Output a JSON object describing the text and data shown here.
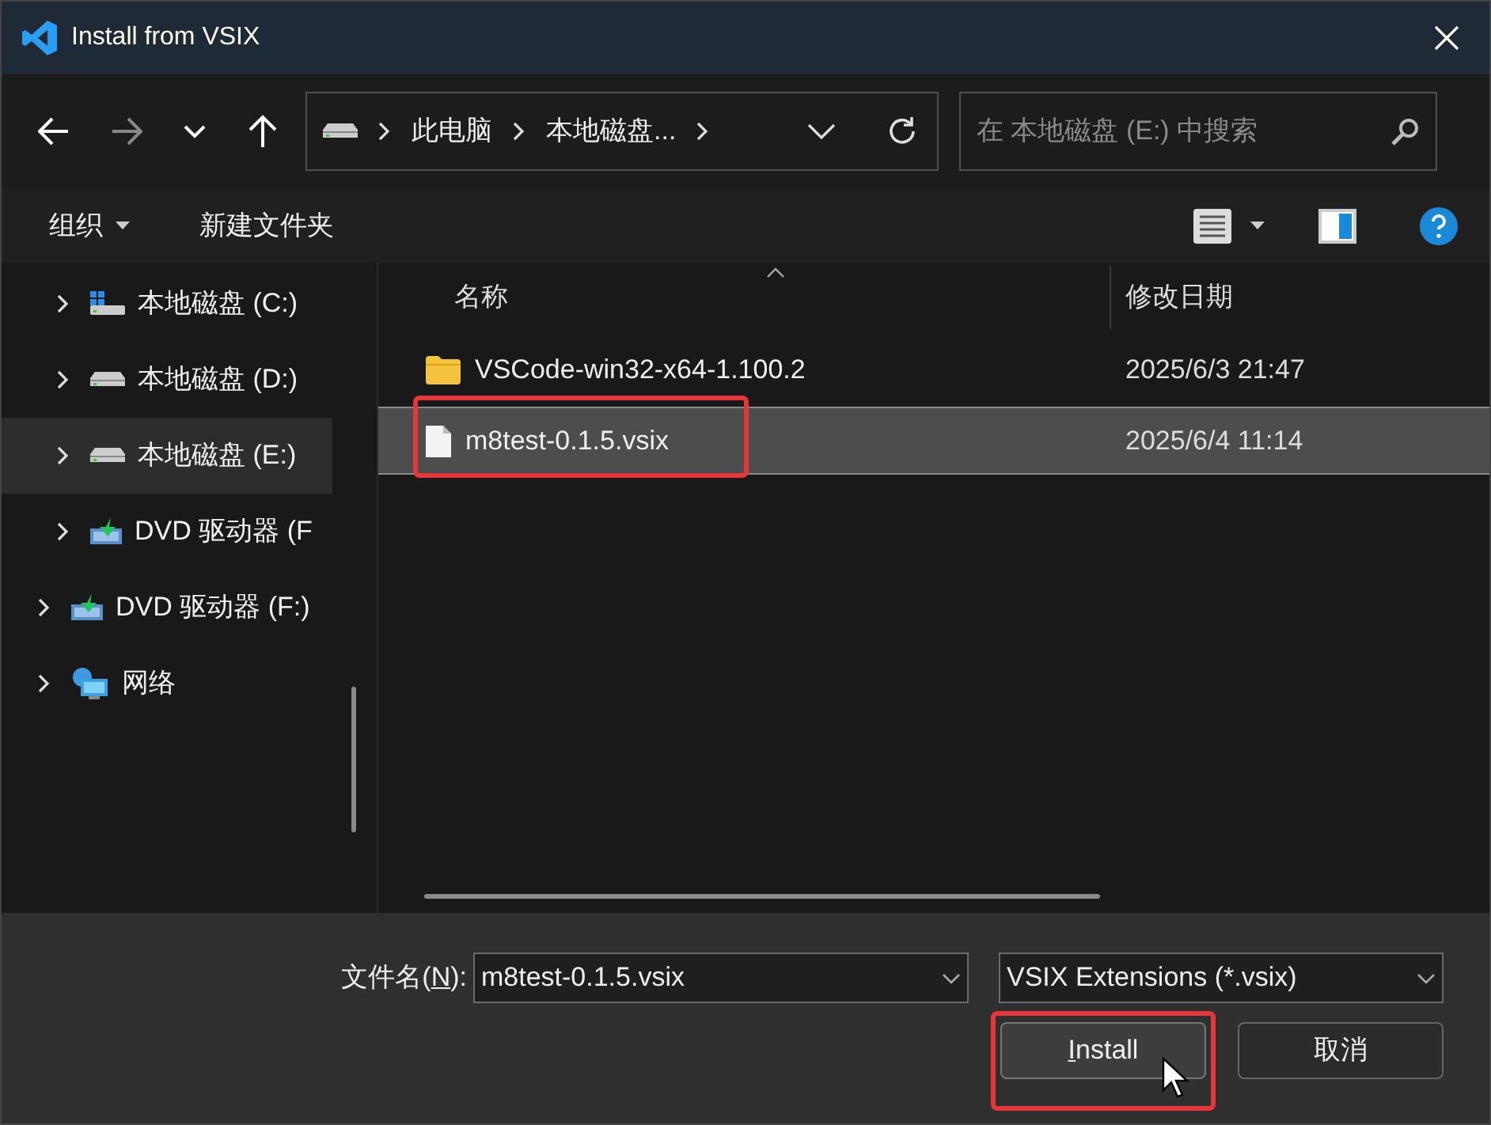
{
  "window": {
    "title": "Install from VSIX"
  },
  "nav": {
    "path": [
      "此电脑",
      "本地磁盘..."
    ],
    "search": {
      "placeholder": "在 本地磁盘 (E:) 中搜索"
    }
  },
  "commands": [
    {
      "label": "组织",
      "dropdown": true
    },
    {
      "label": "新建文件夹",
      "dropdown": false
    }
  ],
  "sidebar": {
    "items": [
      {
        "children": [
          {
            "label": "本地磁盘 (C:)",
            "kind": "system-drive",
            "selected": false
          },
          {
            "label": "本地磁盘 (D:)",
            "kind": "drive",
            "selected": false
          },
          {
            "label": "本地磁盘 (E:)",
            "kind": "drive",
            "selected": true
          },
          {
            "label": "DVD 驱动器 (F",
            "kind": "dvd",
            "selected": false
          }
        ]
      },
      {
        "label": "DVD 驱动器 (F:)",
        "kind": "dvd",
        "selected": false
      },
      {
        "label": "网络",
        "kind": "network",
        "selected": false
      }
    ]
  },
  "table": {
    "columns": [
      "名称",
      "修改日期"
    ],
    "rows": [
      {
        "kind": "folder",
        "name": "VSCode-win32-x64-1.100.2",
        "date": "2025/6/3 21:47",
        "selected": false,
        "highlight": false
      },
      {
        "kind": "file",
        "name": "m8test-0.1.5.vsix",
        "date": "2025/6/4 11:14",
        "selected": true,
        "highlight": true
      }
    ]
  },
  "footer": {
    "filename_label": [
      {
        "text": "文件名(",
        "underline": false
      },
      {
        "text": "N",
        "underline": true
      },
      {
        "text": "):",
        "underline": false
      }
    ],
    "filename": "m8test-0.1.5.vsix",
    "filter": "VSIX Extensions (*.vsix)",
    "buttons": [
      {
        "label": [
          {
            "text": "I",
            "underline": true
          },
          {
            "text": "nstall",
            "underline": false
          }
        ],
        "highlight": true
      },
      {
        "label": [
          {
            "text": "取消",
            "underline": false
          }
        ],
        "highlight": false
      }
    ]
  }
}
